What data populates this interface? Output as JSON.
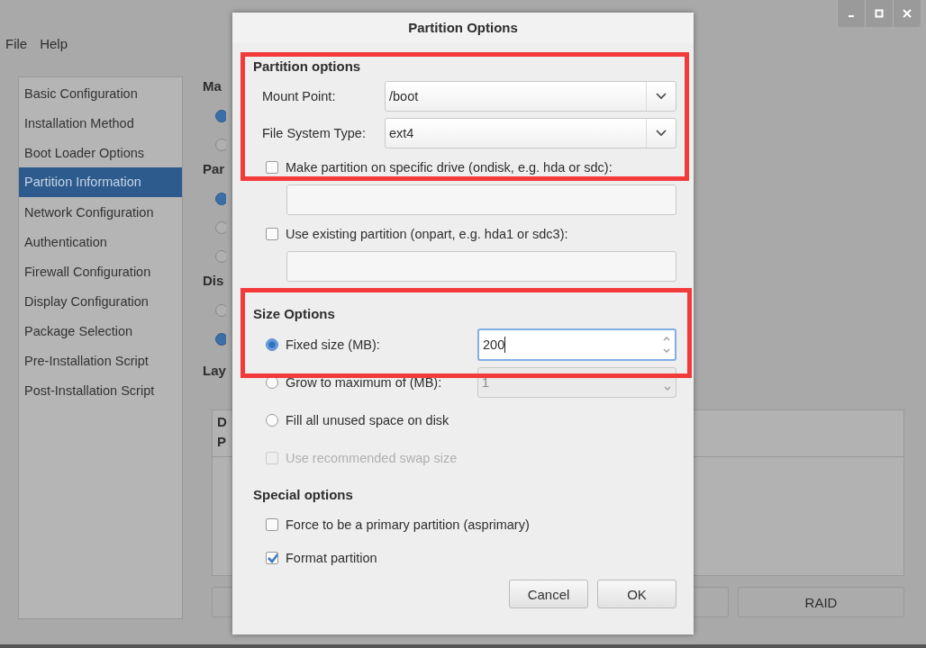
{
  "window": {
    "menu": [
      "File",
      "Help"
    ]
  },
  "sidebar": {
    "items": [
      {
        "label": "Basic Configuration",
        "selected": false
      },
      {
        "label": "Installation Method",
        "selected": false
      },
      {
        "label": "Boot Loader Options",
        "selected": false
      },
      {
        "label": "Partition Information",
        "selected": true
      },
      {
        "label": "Network Configuration",
        "selected": false
      },
      {
        "label": "Authentication",
        "selected": false
      },
      {
        "label": "Firewall Configuration",
        "selected": false
      },
      {
        "label": "Display Configuration",
        "selected": false
      },
      {
        "label": "Package Selection",
        "selected": false
      },
      {
        "label": "Pre-Installation Script",
        "selected": false
      },
      {
        "label": "Post-Installation Script",
        "selected": false
      }
    ]
  },
  "background_form": {
    "sections": [
      {
        "heading": "Ma",
        "radios": [
          {
            "selected": true
          },
          {
            "selected": false
          }
        ]
      },
      {
        "heading": "Par",
        "radios": [
          {
            "selected": true
          },
          {
            "selected": false
          },
          {
            "selected": false
          }
        ]
      },
      {
        "heading": "Dis",
        "radios": [
          {
            "selected": false
          },
          {
            "selected": true
          }
        ]
      }
    ],
    "layout_heading": "Lay",
    "table_header": [
      "D",
      "P"
    ],
    "buttons": [
      {
        "label": "RAID"
      }
    ]
  },
  "dialog": {
    "title": "Partition Options",
    "partition_options": {
      "heading": "Partition options",
      "combos": [
        {
          "label": "Mount Point:",
          "value": "/boot"
        },
        {
          "label": "File System Type:",
          "value": "ext4"
        }
      ],
      "checks": [
        {
          "label": "Make partition on specific drive (ondisk, e.g. hda or sdc):",
          "checked": false
        },
        {
          "label": "Use existing partition (onpart, e.g. hda1 or sdc3):",
          "checked": false
        }
      ]
    },
    "size_options": {
      "heading": "Size Options",
      "rows": [
        {
          "kind": "radio-spin",
          "label": "Fixed size (MB):",
          "selected": true,
          "value": "200",
          "focused": true,
          "disabled": false
        },
        {
          "kind": "radio-spin",
          "label": "Grow to maximum of (MB):",
          "selected": false,
          "value": "1",
          "focused": false,
          "disabled": true
        },
        {
          "kind": "radio",
          "label": "Fill all unused space on disk",
          "selected": false
        },
        {
          "kind": "check",
          "label": "Use recommended swap size",
          "checked": false,
          "disabled": true
        }
      ]
    },
    "special_options": {
      "heading": "Special options",
      "checks": [
        {
          "label": "Force to be a primary partition (asprimary)",
          "checked": false
        },
        {
          "label": "Format partition",
          "checked": true
        }
      ]
    },
    "buttons": [
      {
        "label": "Cancel"
      },
      {
        "label": "OK"
      }
    ]
  }
}
